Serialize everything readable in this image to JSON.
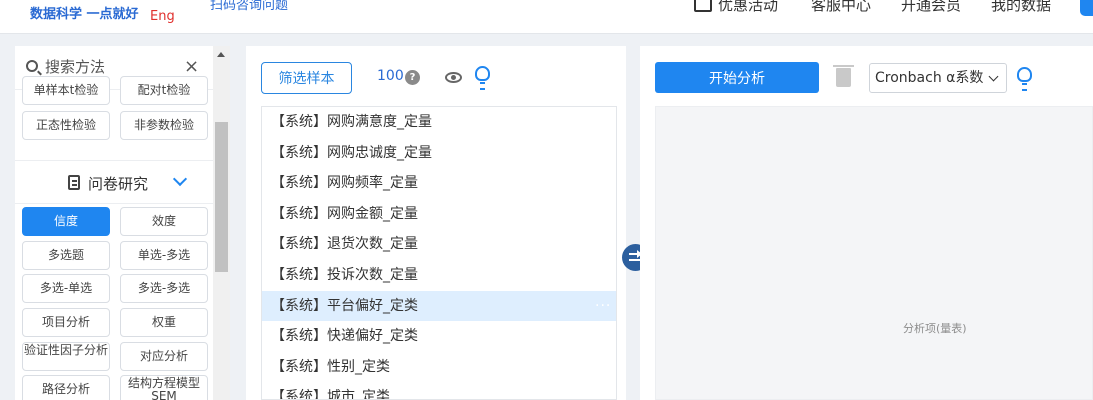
{
  "topbar": {
    "brand": "数据科学 一点就好",
    "lang": "Eng",
    "scan_help": "扫码咨询问题",
    "nav": [
      "优惠活动",
      "客服中心",
      "开通会员",
      "我的数据"
    ]
  },
  "sidebar": {
    "search_placeholder": "搜索方法",
    "top_buttons": [
      "单样本t检验",
      "配对t检验",
      "正态性检验",
      "非参数检验"
    ],
    "section_title": "问卷研究",
    "methods": [
      "信度",
      "效度",
      "多选题",
      "单选-多选",
      "多选-单选",
      "多选-多选",
      "项目分析",
      "权重",
      "验证性因子分析",
      "对应分析",
      "路径分析",
      "结构方程模型SEM"
    ],
    "active_method": "信度"
  },
  "variables": {
    "filter_label": "筛选样本",
    "sample_count": "100",
    "items": [
      "【系统】网购满意度_定量",
      "【系统】网购忠诚度_定量",
      "【系统】网购频率_定量",
      "【系统】网购金额_定量",
      "【系统】退货次数_定量",
      "【系统】投诉次数_定量",
      "【系统】平台偏好_定类",
      "【系统】快递偏好_定类",
      "【系统】性别_定类",
      "【系统】城市_定类"
    ],
    "highlighted_index": 6
  },
  "analysis": {
    "start_label": "开始分析",
    "method_selected": "Cronbach α系数",
    "drop_label": "分析项(量表)"
  },
  "colors": {
    "accent": "#1f86f0",
    "highlight_row": "#deeefe",
    "swap_button": "#2c5f9e"
  },
  "icons": [
    "search-icon",
    "close-icon",
    "document-icon",
    "chevron-down-icon",
    "help-icon",
    "eye-icon",
    "lightbulb-icon",
    "swap-icon",
    "trash-icon",
    "more-icon",
    "gift-icon"
  ]
}
